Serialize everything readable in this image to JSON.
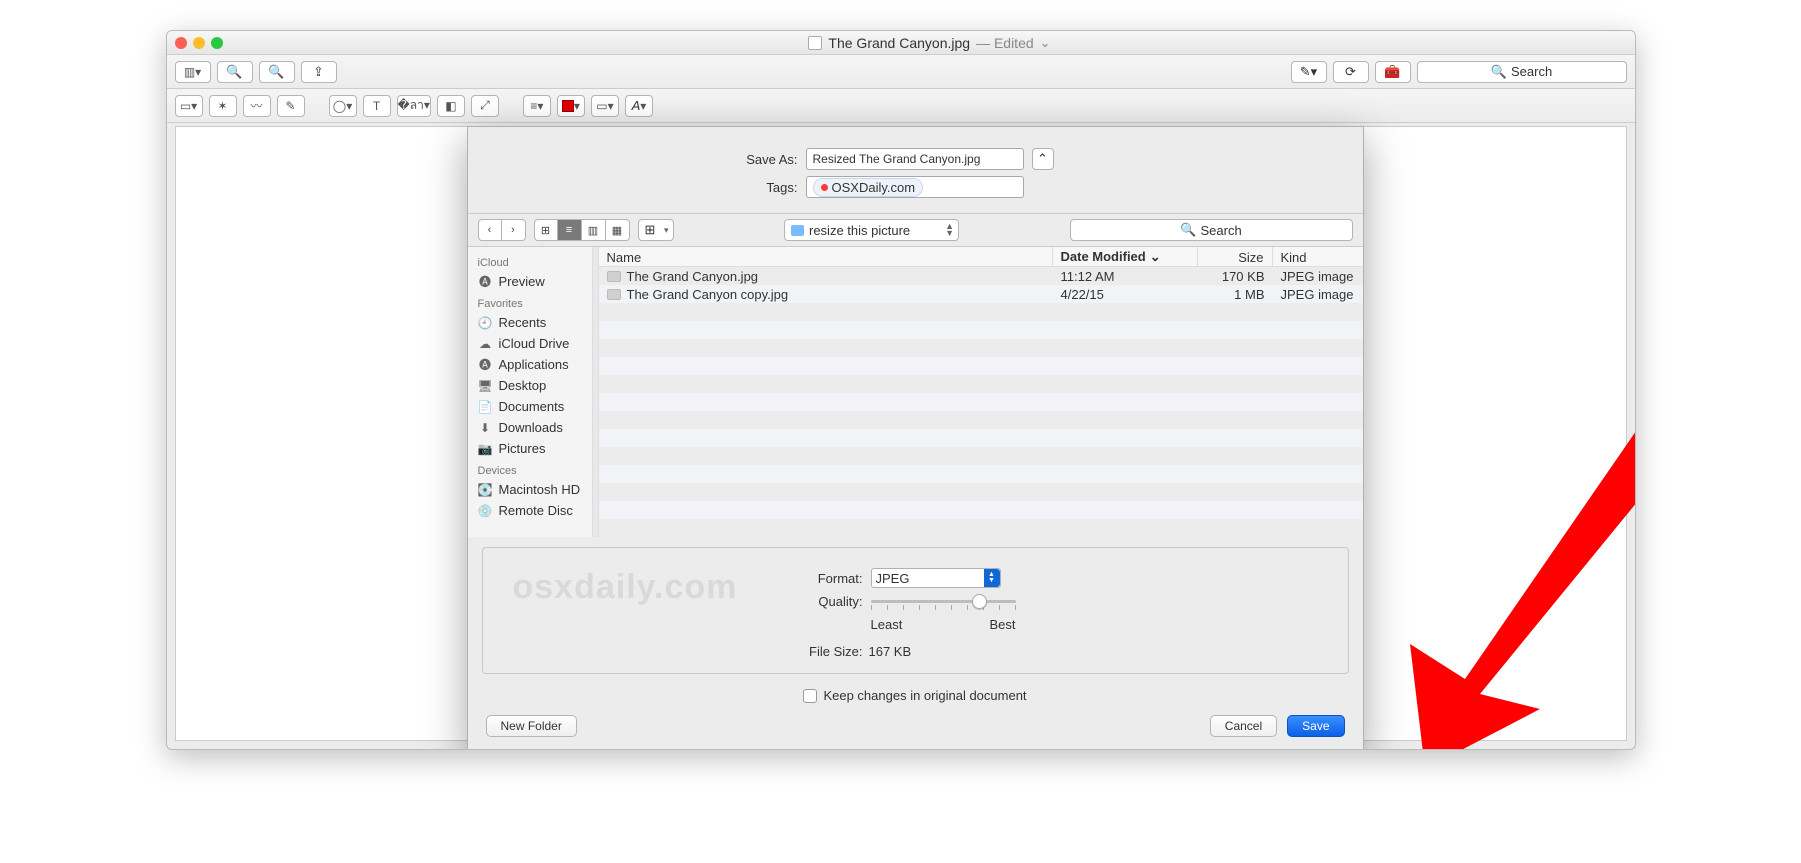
{
  "title": {
    "filename": "The Grand Canyon.jpg",
    "edited": "— Edited"
  },
  "toolbar": {
    "search_placeholder": "Search"
  },
  "sheet": {
    "save_as_label": "Save As:",
    "save_as_value": "Resized The Grand Canyon.jpg",
    "tags_label": "Tags:",
    "tag_value": "OSXDaily.com",
    "folder": "resize this picture",
    "search_placeholder": "Search"
  },
  "sidebar": {
    "s1": "iCloud",
    "s2": "Favorites",
    "s3": "Devices",
    "items": {
      "preview": "Preview",
      "recents": "Recents",
      "icloud": "iCloud Drive",
      "apps": "Applications",
      "desktop": "Desktop",
      "docs": "Documents",
      "downloads": "Downloads",
      "pics": "Pictures",
      "mac": "Macintosh HD",
      "remote": "Remote Disc"
    }
  },
  "columns": {
    "name": "Name",
    "date": "Date Modified",
    "size": "Size",
    "kind": "Kind"
  },
  "files": [
    {
      "name": "The Grand Canyon.jpg",
      "date": "11:12 AM",
      "size": "170 KB",
      "kind": "JPEG image"
    },
    {
      "name": "The Grand Canyon copy.jpg",
      "date": "4/22/15",
      "size": "1 MB",
      "kind": "JPEG image"
    }
  ],
  "format": {
    "watermark": "osxdaily.com",
    "label": "Format:",
    "value": "JPEG",
    "quality_label": "Quality:",
    "least": "Least",
    "best": "Best",
    "filesize_label": "File Size:",
    "filesize_value": "167 KB"
  },
  "keep_label": "Keep changes in original document",
  "buttons": {
    "new_folder": "New Folder",
    "cancel": "Cancel",
    "save": "Save"
  }
}
